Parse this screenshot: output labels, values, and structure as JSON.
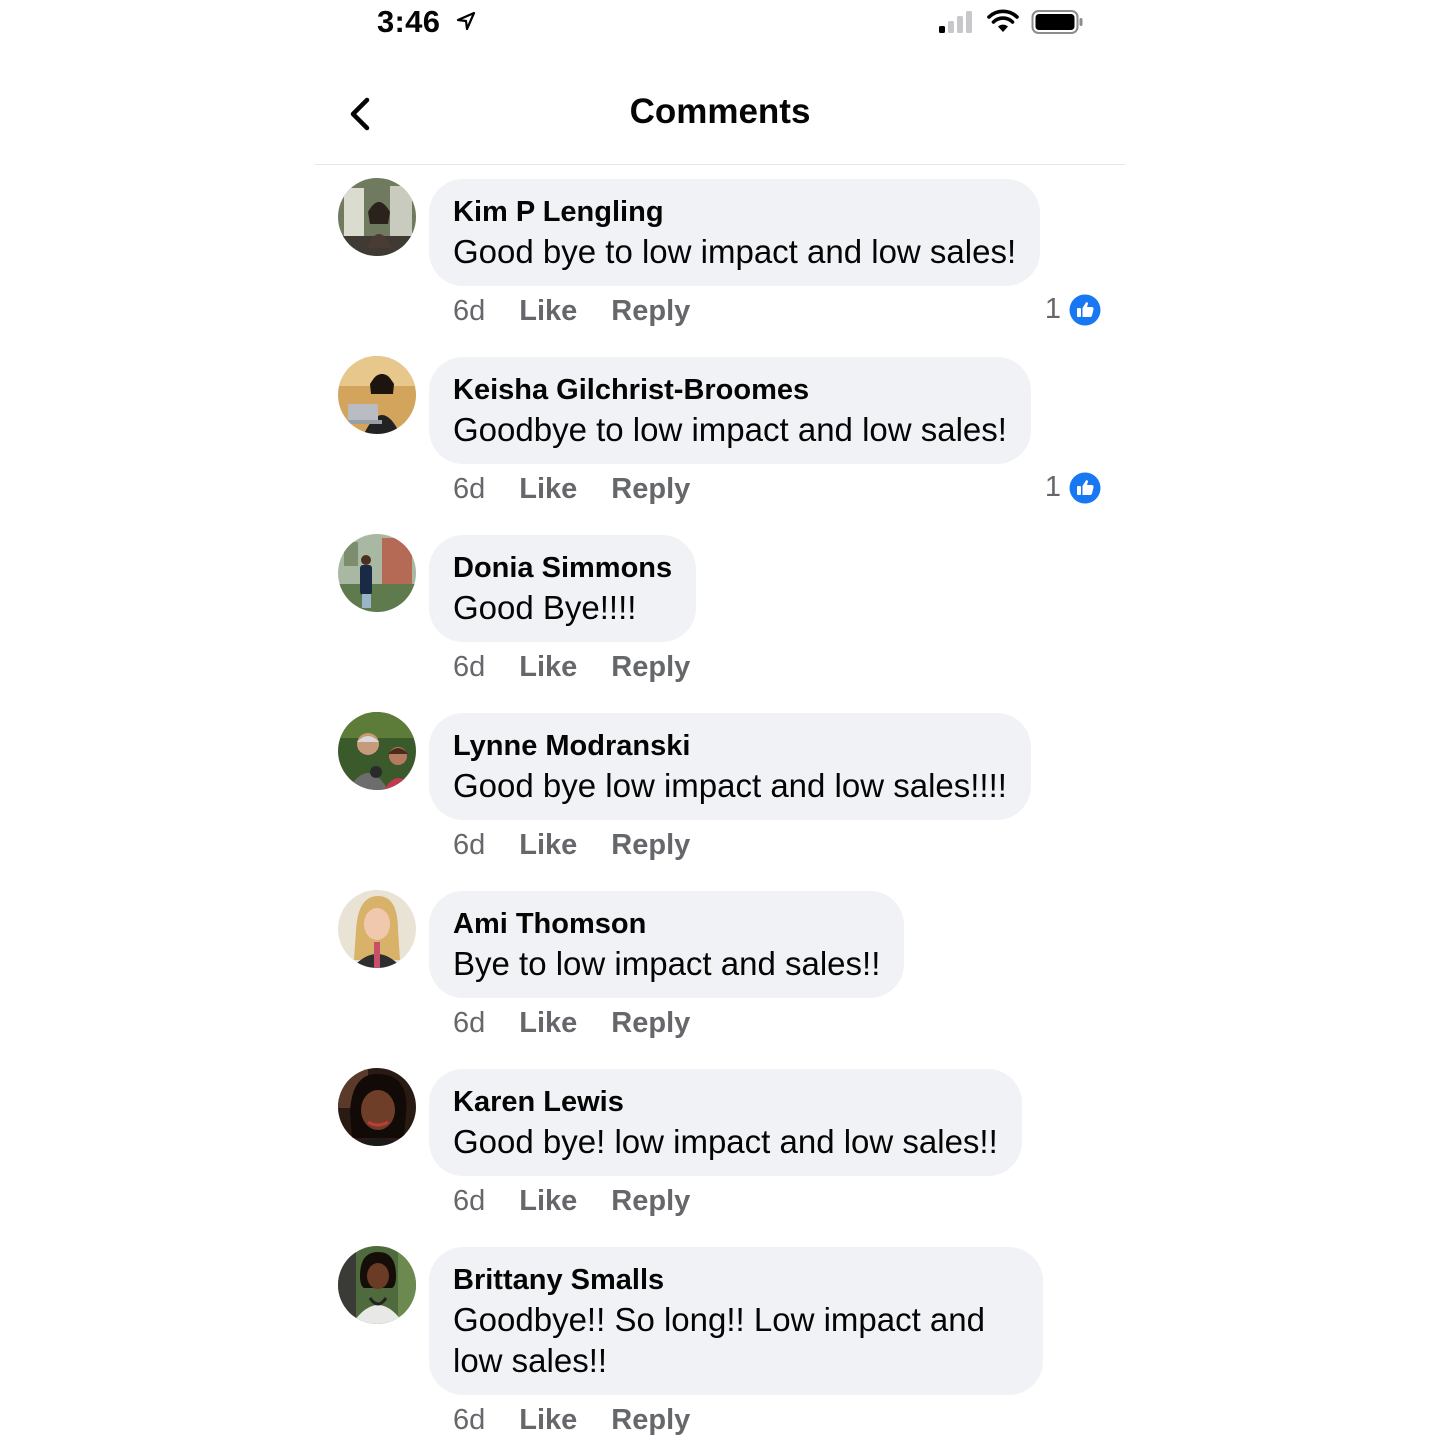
{
  "status_bar": {
    "time": "3:46",
    "icons": [
      "location-arrow-icon",
      "cellular-signal-icon",
      "wifi-icon",
      "battery-icon"
    ]
  },
  "nav": {
    "title": "Comments",
    "back_icon": "chevron-left-icon"
  },
  "colors": {
    "bubble": "#f0f2f5",
    "meta_text": "#65676b",
    "like_blue": "#1877f2",
    "divider": "#e4e6eb"
  },
  "comments": [
    {
      "author": "Kim P Lengling",
      "text": "Good bye to low impact and low sales!",
      "time": "6d",
      "like_label": "Like",
      "reply_label": "Reply",
      "reaction_count": "1",
      "reaction_icon": "thumbs-up-icon"
    },
    {
      "author": "Keisha Gilchrist-Broomes",
      "text": "Goodbye to low impact and low sales!",
      "time": "6d",
      "like_label": "Like",
      "reply_label": "Reply",
      "reaction_count": "1",
      "reaction_icon": "thumbs-up-icon"
    },
    {
      "author": "Donia Simmons",
      "text": "Good Bye!!!!",
      "time": "6d",
      "like_label": "Like",
      "reply_label": "Reply"
    },
    {
      "author": "Lynne Modranski",
      "text": "Good bye low impact and low sales!!!!",
      "time": "6d",
      "like_label": "Like",
      "reply_label": "Reply"
    },
    {
      "author": "Ami Thomson",
      "text": "Bye to low impact and sales!!",
      "time": "6d",
      "like_label": "Like",
      "reply_label": "Reply"
    },
    {
      "author": "Karen Lewis",
      "text": "Good bye! low impact and low sales!!",
      "time": "6d",
      "like_label": "Like",
      "reply_label": "Reply"
    },
    {
      "author": "Brittany Smalls",
      "text": "Goodbye!! So long!! Low impact and low sales!!",
      "time": "6d",
      "like_label": "Like",
      "reply_label": "Reply"
    }
  ]
}
